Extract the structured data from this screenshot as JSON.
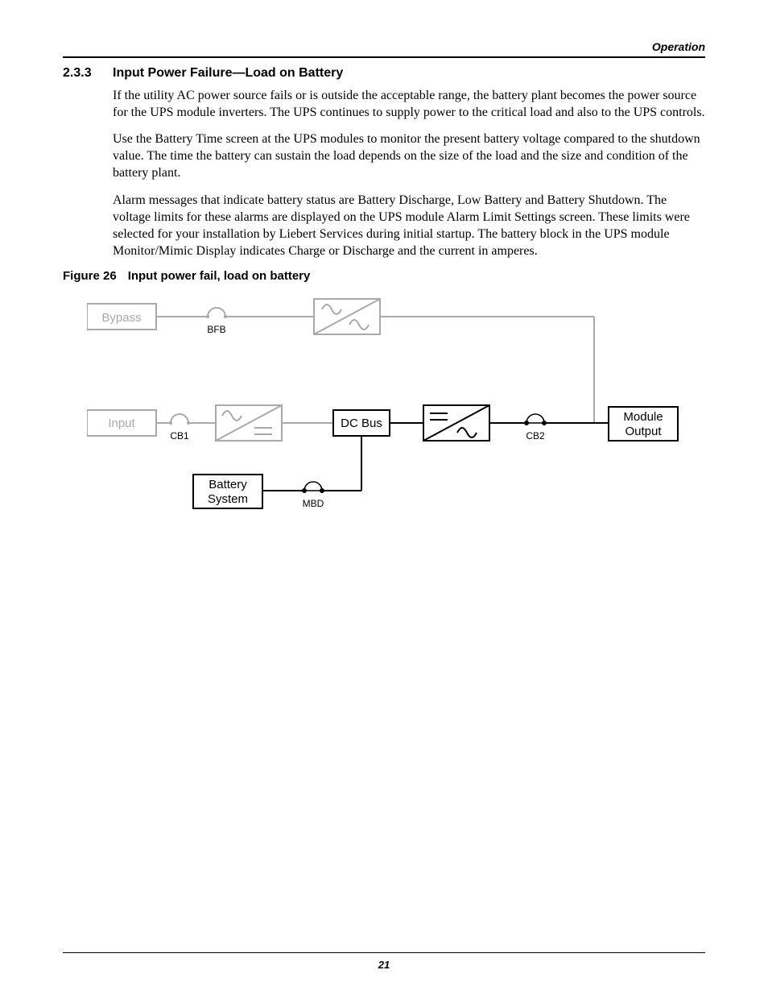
{
  "header": {
    "section": "Operation"
  },
  "section": {
    "number": "2.3.3",
    "title": "Input Power Failure—Load on Battery",
    "p1": "If the utility AC power source fails or is outside the acceptable range, the battery plant becomes the power source for the UPS module inverters. The UPS continues to supply power to the critical load and also to the UPS controls.",
    "p2": "Use the Battery Time screen at the UPS modules to monitor the present battery voltage compared to the shutdown value. The time the battery can sustain the load depends on the size of the load and the size and condition of the battery plant.",
    "p3": "Alarm messages that indicate battery status are Battery Discharge, Low Battery and Battery Shutdown. The voltage limits for these alarms are displayed on the UPS module Alarm Limit Settings screen. These limits were selected for your installation by Liebert Services during initial startup. The battery block in the UPS module Monitor/Mimic Display indicates Charge or Discharge and the current in amperes."
  },
  "figure": {
    "label": "Figure 26",
    "title": "Input power fail, load on battery",
    "blocks": {
      "bypass": "Bypass",
      "input": "Input",
      "dcbus": "DC Bus",
      "module_out1": "Module",
      "module_out2": "Output",
      "battery1": "Battery",
      "battery2": "System"
    },
    "breakers": {
      "bfb": "BFB",
      "cb1": "CB1",
      "cb2": "CB2",
      "mbd": "MBD"
    }
  },
  "page_number": "21"
}
